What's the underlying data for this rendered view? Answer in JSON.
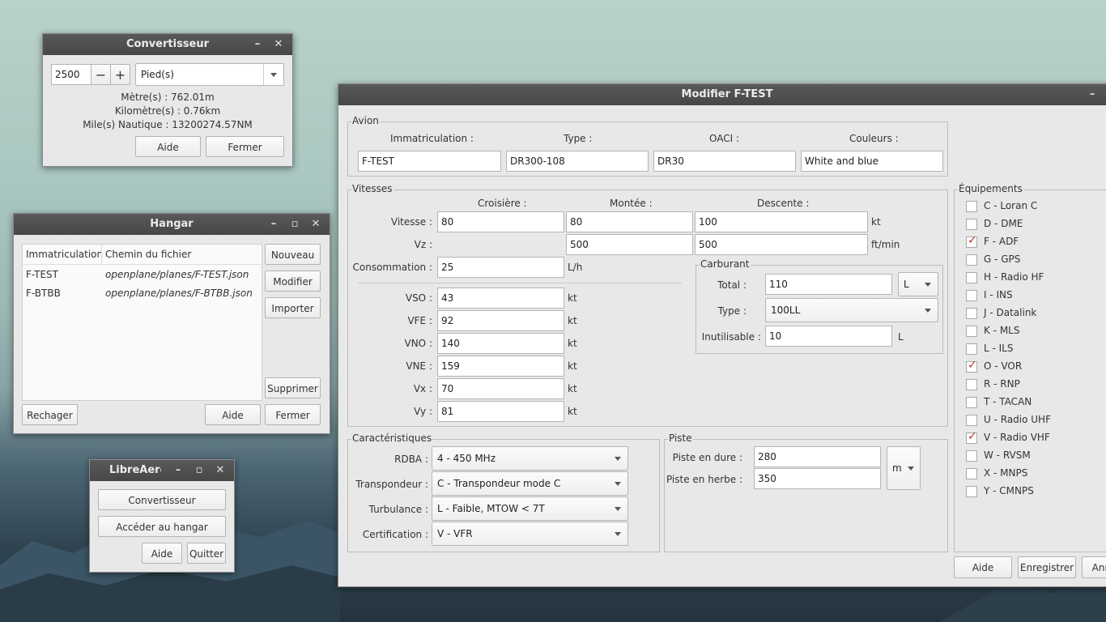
{
  "converter": {
    "title": "Convertisseur",
    "value": "2500",
    "minus": "−",
    "plus": "+",
    "unit": "Pied(s)",
    "meters": "Mètre(s) : 762.01m",
    "km": "Kilomètre(s) : 0.76km",
    "nm": "Mile(s) Nautique : 13200274.57NM",
    "help": "Aide",
    "close": "Fermer"
  },
  "hangar": {
    "title": "Hangar",
    "col_reg": "Immatriculation",
    "col_path": "Chemin du fichier",
    "rows": [
      {
        "reg": "F-TEST",
        "path": "openplane/planes/F-TEST.json"
      },
      {
        "reg": "F-BTBB",
        "path": "openplane/planes/F-BTBB.json"
      }
    ],
    "new": "Nouveau",
    "edit": "Modifier",
    "import": "Importer",
    "delete": "Supprimer",
    "reload": "Rechager",
    "help": "Aide",
    "close": "Fermer"
  },
  "launcher": {
    "title": "LibreAero",
    "converter": "Convertisseur",
    "hangar": "Accéder au hangar",
    "help": "Aide",
    "quit": "Quitter"
  },
  "editor": {
    "title": "Modifier F-TEST",
    "avion": {
      "title": "Avion",
      "reg_label": "Immatriculation :",
      "type_label": "Type :",
      "oaci_label": "OACI :",
      "colors_label": "Couleurs :",
      "reg": "F-TEST",
      "type": "DR300-108",
      "oaci": "DR30",
      "colors": "White and blue"
    },
    "vitesses": {
      "title": "Vitesses",
      "cruise": "Croisière :",
      "climb": "Montée :",
      "descent": "Descente :",
      "speed_label": "Vitesse :",
      "speed_cruise": "80",
      "speed_climb": "80",
      "speed_descent": "100",
      "speed_unit": "kt",
      "vz_label": "Vz :",
      "vz_climb": "500",
      "vz_descent": "500",
      "vz_unit": "ft/min",
      "cons_label": "Consommation :",
      "cons": "25",
      "cons_unit": "L/h",
      "vso_label": "VSO :",
      "vso": "43",
      "vfe_label": "VFE :",
      "vfe": "92",
      "vno_label": "VNO :",
      "vno": "140",
      "vne_label": "VNE :",
      "vne": "159",
      "vx_label": "Vx :",
      "vx": "70",
      "vy_label": "Vy :",
      "vy": "81",
      "kt": "kt"
    },
    "carburant": {
      "title": "Carburant",
      "total_label": "Total :",
      "total": "110",
      "total_unit": "L",
      "type_label": "Type :",
      "type": "100LL",
      "unusable_label": "Inutilisable :",
      "unusable": "10",
      "unusable_unit": "L"
    },
    "carac": {
      "title": "Caractéristiques",
      "rdba_label": "RDBA :",
      "rdba": "4 - 450 MHz",
      "transp_label": "Transpondeur :",
      "transp": "C - Transpondeur mode C",
      "turb_label": "Turbulance :",
      "turb": "L - Faible, MTOW < 7T",
      "cert_label": "Certification :",
      "cert": "V - VFR"
    },
    "piste": {
      "title": "Piste",
      "hard_label": "Piste en dure :",
      "hard": "280",
      "grass_label": "Piste en herbe :",
      "grass": "350",
      "unit": "m"
    },
    "equip": {
      "title": "Équipements",
      "items": [
        {
          "label": "C - Loran C",
          "checked": false
        },
        {
          "label": "D - DME",
          "checked": false
        },
        {
          "label": "F - ADF",
          "checked": true
        },
        {
          "label": "G - GPS",
          "checked": false
        },
        {
          "label": "H - Radio HF",
          "checked": false
        },
        {
          "label": "I - INS",
          "checked": false
        },
        {
          "label": "J - Datalink",
          "checked": false
        },
        {
          "label": "K - MLS",
          "checked": false
        },
        {
          "label": "L - ILS",
          "checked": false
        },
        {
          "label": "O - VOR",
          "checked": true
        },
        {
          "label": "R - RNP",
          "checked": false
        },
        {
          "label": "T - TACAN",
          "checked": false
        },
        {
          "label": "U - Radio UHF",
          "checked": false
        },
        {
          "label": "V - Radio VHF",
          "checked": true
        },
        {
          "label": "W - RVSM",
          "checked": false
        },
        {
          "label": "X - MNPS",
          "checked": false
        },
        {
          "label": "Y - CMNPS",
          "checked": false
        }
      ]
    },
    "help": "Aide",
    "save": "Enregistrer",
    "cancel": "Annuler"
  }
}
